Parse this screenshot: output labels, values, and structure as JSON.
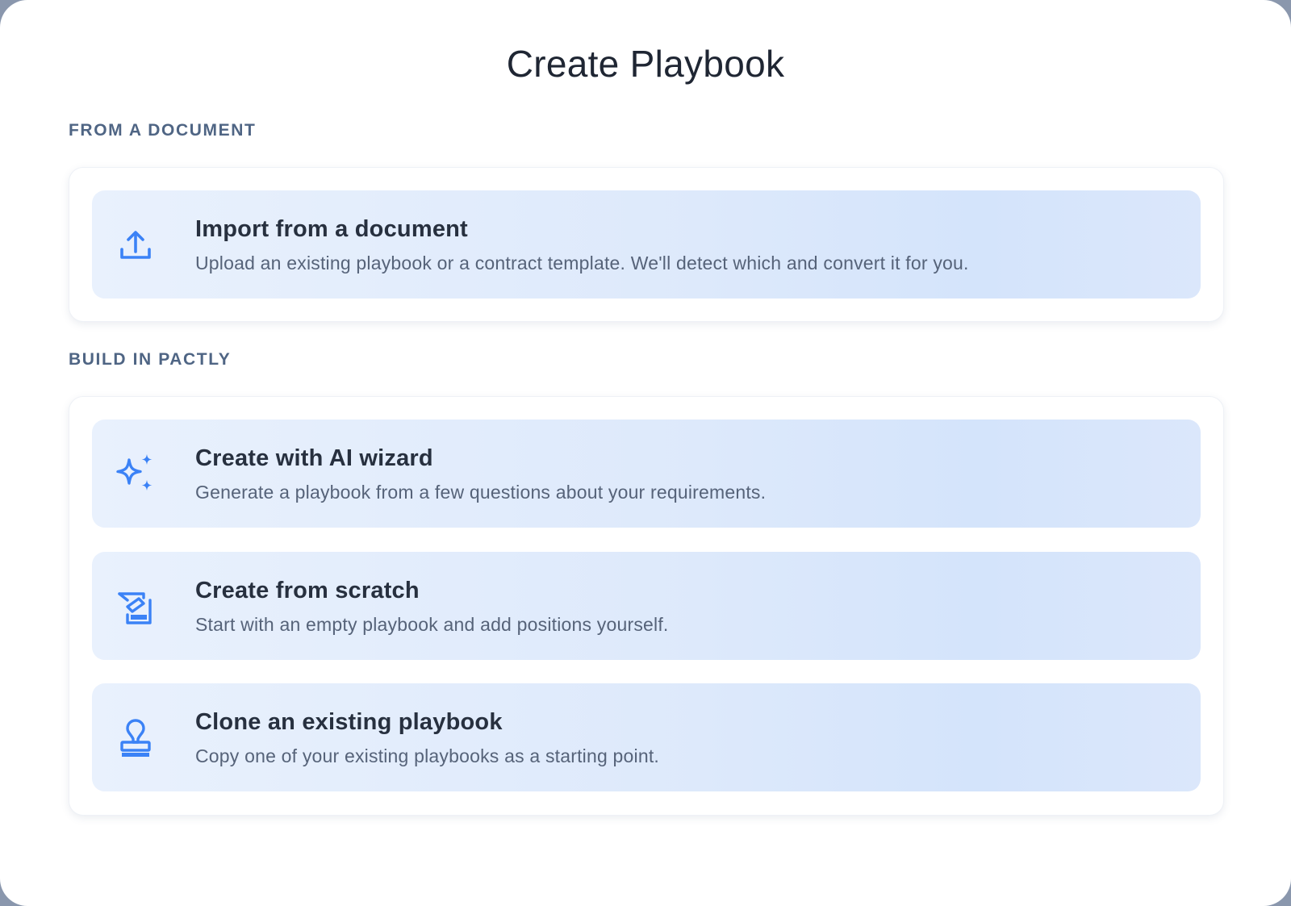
{
  "dialog": {
    "title": "Create Playbook"
  },
  "sections": [
    {
      "label": "FROM A DOCUMENT",
      "options": [
        {
          "icon": "upload-icon",
          "title": "Import from a document",
          "description": "Upload an existing playbook or a contract template. We'll detect which and convert it for you."
        }
      ]
    },
    {
      "label": "BUILD IN PACTLY",
      "options": [
        {
          "icon": "sparkles-icon",
          "title": "Create with AI wizard",
          "description": "Generate a playbook from a few questions about your requirements."
        },
        {
          "icon": "edit-document-icon",
          "title": "Create from scratch",
          "description": "Start with an empty playbook and add positions yourself."
        },
        {
          "icon": "stamp-icon",
          "title": "Clone an existing playbook",
          "description": "Copy one of your existing playbooks as a starting point."
        }
      ]
    }
  ],
  "colors": {
    "accent": "#3b82f6",
    "section_label": "#4f6584",
    "title_text": "#1f2633",
    "card_background": "#dde9fb"
  }
}
